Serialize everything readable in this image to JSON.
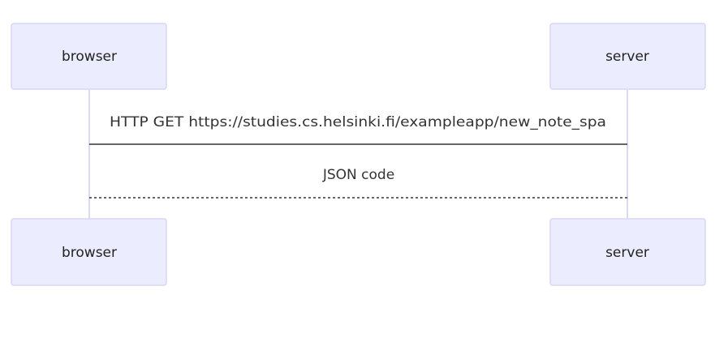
{
  "participants": [
    {
      "id": "browser",
      "label": "browser"
    },
    {
      "id": "server",
      "label": "server"
    }
  ],
  "messages": [
    {
      "from": "browser",
      "to": "server",
      "label": "HTTP GET https://studies.cs.helsinki.fi/exampleapp/new_note_spa",
      "style": "solid"
    },
    {
      "from": "server",
      "to": "browser",
      "label": "JSON code",
      "style": "dotted"
    }
  ],
  "colors": {
    "actor_fill": "#ececff",
    "actor_stroke": "#d6d6f5",
    "lifeline": "#d9d9f2",
    "message_line": "#333333"
  }
}
